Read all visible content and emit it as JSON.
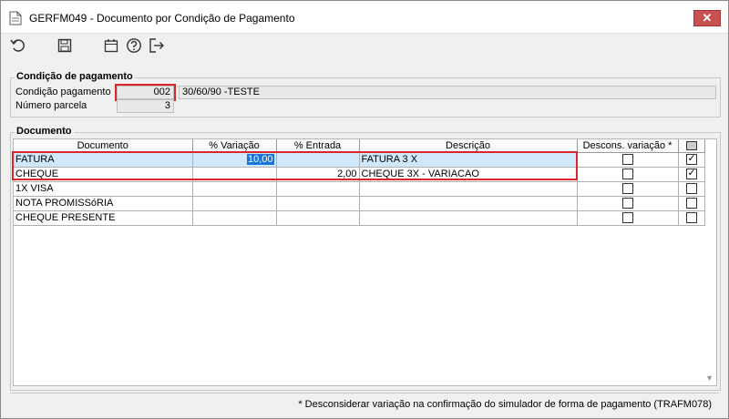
{
  "window": {
    "title": "GERFM049 - Documento por Condição de Pagamento",
    "close_label": "✕"
  },
  "toolbar": {
    "icons": [
      "undo-icon",
      "save-icon",
      "calendar-icon",
      "help-icon",
      "exit-icon"
    ]
  },
  "payment_condition": {
    "group_title": "Condição de pagamento",
    "condition_label": "Condição pagamento",
    "condition_code": "002",
    "condition_description": "30/60/90 -TESTE",
    "installments_label": "Número parcela",
    "installments_value": "3"
  },
  "document": {
    "group_title": "Documento",
    "columns": [
      "Documento",
      "% Variação",
      "% Entrada",
      "Descrição",
      "Descons. variação *"
    ],
    "rows": [
      {
        "documento": "FATURA",
        "variacao": "10,00",
        "entrada": "",
        "descricao": "FATURA 3 X",
        "descons": false,
        "active": true,
        "selected": true
      },
      {
        "documento": "CHEQUE",
        "variacao": "",
        "entrada": "2,00",
        "descricao": "CHEQUE 3X - VARIACAO",
        "descons": false,
        "active": true,
        "selected": false
      },
      {
        "documento": "1X VISA",
        "variacao": "",
        "entrada": "",
        "descricao": "",
        "descons": false,
        "active": false,
        "selected": false
      },
      {
        "documento": "NOTA PROMISSóRIA",
        "variacao": "",
        "entrada": "",
        "descricao": "",
        "descons": false,
        "active": false,
        "selected": false
      },
      {
        "documento": "CHEQUE PRESENTE",
        "variacao": "",
        "entrada": "",
        "descricao": "",
        "descons": false,
        "active": false,
        "selected": false
      }
    ]
  },
  "footer": {
    "note": "* Desconsiderar variação na confirmação do simulador de forma de pagamento (TRAFM078)"
  },
  "colors": {
    "highlight_border": "#d9262b",
    "selected_row": "#cfe8fb",
    "edit_selection": "#1874d6",
    "close_button": "#c75050"
  }
}
